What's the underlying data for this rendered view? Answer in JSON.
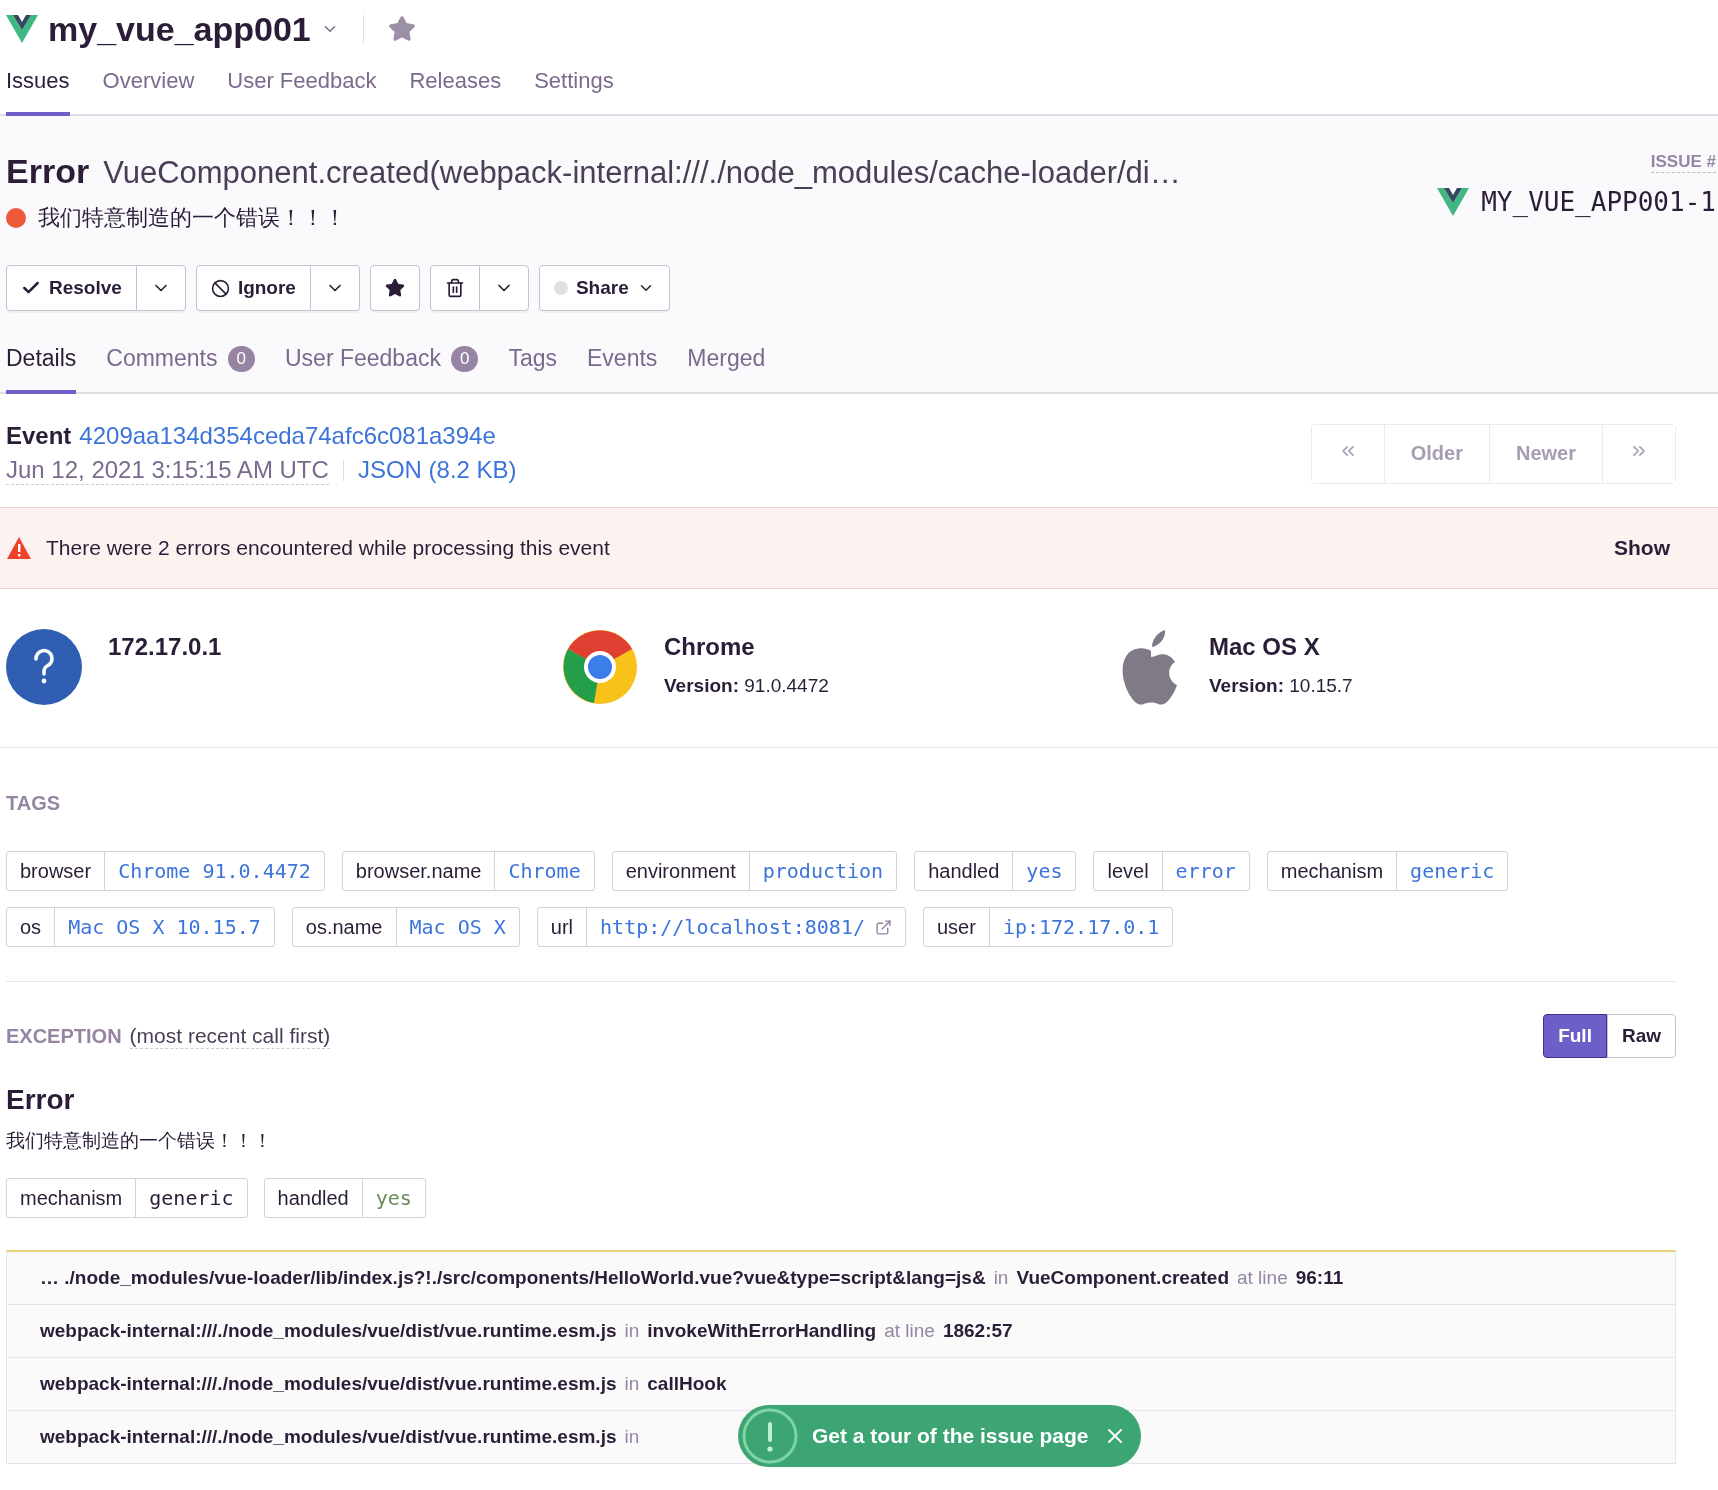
{
  "project": {
    "name": "my_vue_app001"
  },
  "nav_tabs": [
    {
      "label": "Issues",
      "selected": true
    },
    {
      "label": "Overview",
      "selected": false
    },
    {
      "label": "User Feedback",
      "selected": false
    },
    {
      "label": "Releases",
      "selected": false
    },
    {
      "label": "Settings",
      "selected": false
    }
  ],
  "issue": {
    "type": "Error",
    "culprit": "VueComponent.created(webpack-internal:///./node_modules/cache-loader/di…",
    "message": "我们特意制造的一个错误！！！",
    "issue_label": "ISSUE #",
    "short_id": "MY_VUE_APP001-1"
  },
  "actions": {
    "resolve": "Resolve",
    "ignore": "Ignore",
    "share": "Share"
  },
  "detail_tabs": [
    {
      "label": "Details",
      "selected": true
    },
    {
      "label": "Comments",
      "count": "0",
      "selected": false
    },
    {
      "label": "User Feedback",
      "count": "0",
      "selected": false
    },
    {
      "label": "Tags",
      "selected": false
    },
    {
      "label": "Events",
      "selected": false
    },
    {
      "label": "Merged",
      "selected": false
    }
  ],
  "event": {
    "label": "Event",
    "id": "4209aa134d354ceda74afc6c081a394e",
    "date": "Jun 12, 2021 3:15:15 AM UTC",
    "json_link": "JSON (8.2 KB)"
  },
  "pagination": {
    "older": "Older",
    "newer": "Newer",
    "disabled": true
  },
  "alert": {
    "message": "There were 2 errors encountered while processing this event",
    "action": "Show"
  },
  "contexts": [
    {
      "kind": "user",
      "title": "172.17.0.1"
    },
    {
      "kind": "browser",
      "title": "Chrome",
      "version_label": "Version:",
      "version": "91.0.4472"
    },
    {
      "kind": "os",
      "title": "Mac OS X",
      "version_label": "Version:",
      "version": "10.15.7"
    }
  ],
  "tags": {
    "heading": "TAGS",
    "items": [
      {
        "key": "browser",
        "value": "Chrome 91.0.4472"
      },
      {
        "key": "browser.name",
        "value": "Chrome"
      },
      {
        "key": "environment",
        "value": "production"
      },
      {
        "key": "handled",
        "value": "yes"
      },
      {
        "key": "level",
        "value": "error"
      },
      {
        "key": "mechanism",
        "value": "generic"
      },
      {
        "key": "os",
        "value": "Mac OS X 10.15.7"
      },
      {
        "key": "os.name",
        "value": "Mac OS X"
      },
      {
        "key": "url",
        "value": "http://localhost:8081/",
        "external": true
      },
      {
        "key": "user",
        "value": "ip:172.17.0.1"
      }
    ]
  },
  "exception": {
    "heading": "EXCEPTION",
    "subheading": "(most recent call first)",
    "views": [
      {
        "label": "Full",
        "selected": true
      },
      {
        "label": "Raw",
        "selected": false
      }
    ],
    "type": "Error",
    "value": "我们特意制造的一个错误！！！",
    "mechanism": [
      {
        "key": "mechanism",
        "value": "generic"
      },
      {
        "key": "handled",
        "value": "yes"
      }
    ],
    "frames": [
      {
        "file": "… ./node_modules/vue-loader/lib/index.js?!./src/components/HelloWorld.vue?vue&type=script&lang=js&",
        "in": "in",
        "function": "VueComponent.created",
        "at": "at line",
        "line": "96:11"
      },
      {
        "file": "webpack-internal:///./node_modules/vue/dist/vue.runtime.esm.js",
        "in": "in",
        "function": "invokeWithErrorHandling",
        "at": "at line",
        "line": "1862:57"
      },
      {
        "file": "webpack-internal:///./node_modules/vue/dist/vue.runtime.esm.js",
        "in": "in",
        "function": "callHook"
      },
      {
        "file": "webpack-internal:///./node_modules/vue/dist/vue.runtime.esm.js",
        "in": "in"
      }
    ]
  },
  "tour": {
    "label": "Get a tour of the issue page"
  }
}
